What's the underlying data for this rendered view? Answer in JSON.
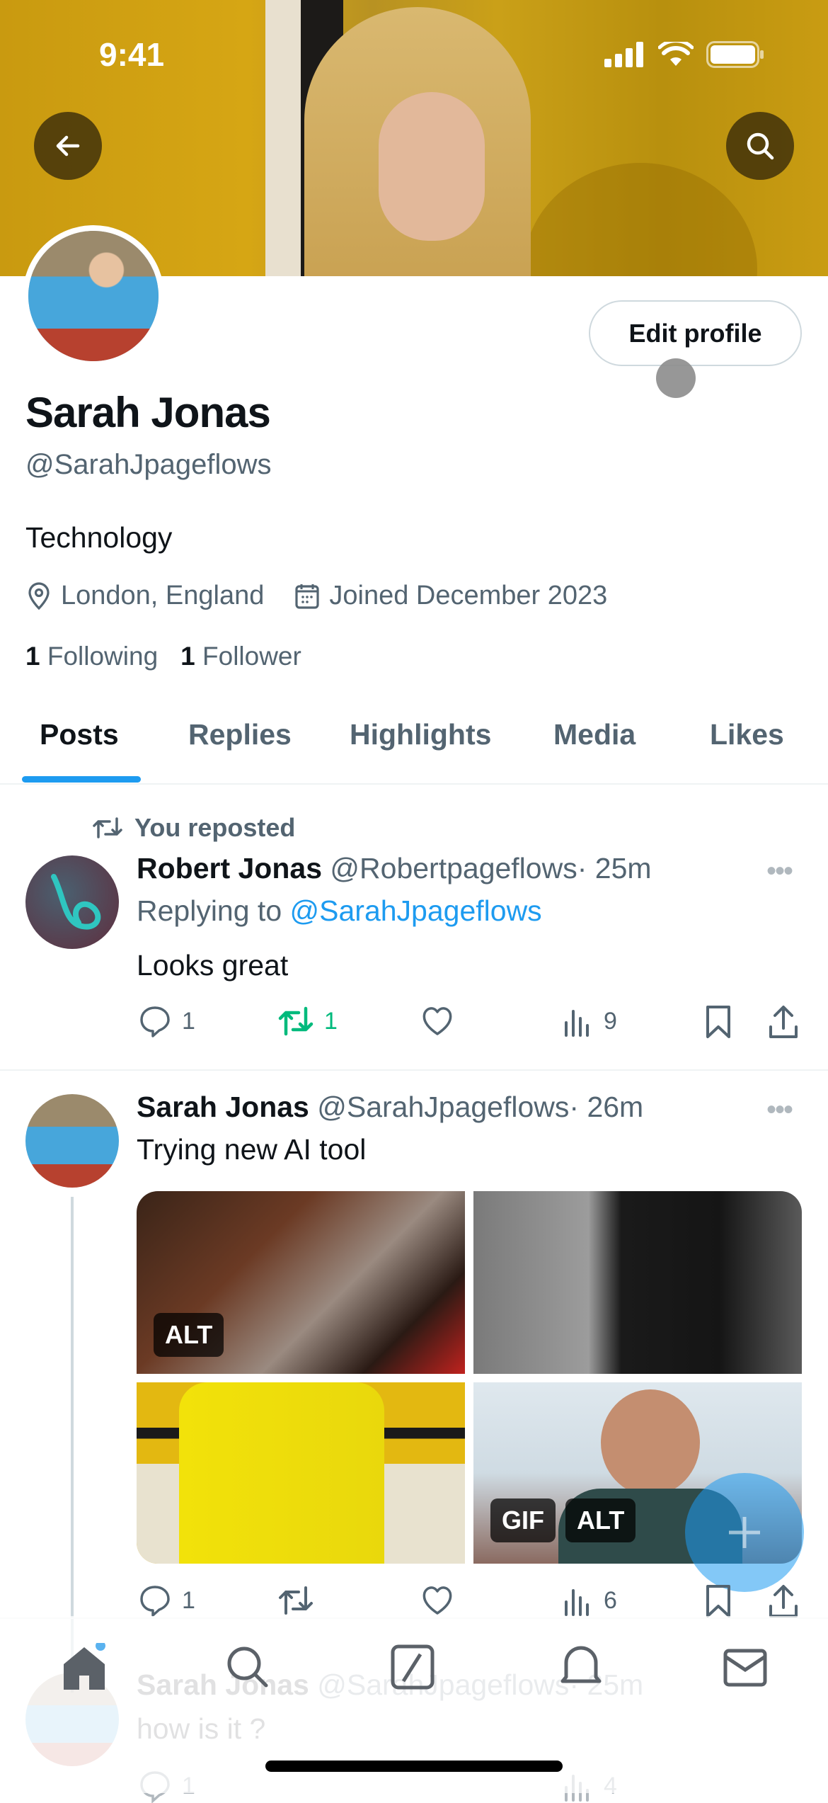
{
  "status_bar": {
    "time": "9:41"
  },
  "header": {
    "back_label": "Back",
    "search_label": "Search"
  },
  "profile": {
    "name": "Sarah Jonas",
    "handle": "@SarahJpageflows",
    "bio": "Technology",
    "location": "London, England",
    "joined": "Joined December 2023",
    "following_count": "1",
    "following_label": "Following",
    "followers_count": "1",
    "followers_label": "Follower",
    "edit_button": "Edit profile"
  },
  "tabs": [
    {
      "label": "Posts",
      "active": true
    },
    {
      "label": "Replies"
    },
    {
      "label": "Highlights"
    },
    {
      "label": "Media"
    },
    {
      "label": "Likes"
    }
  ],
  "posts": [
    {
      "context": "You reposted",
      "author": "Robert Jonas",
      "handle": "@Robertpageflows",
      "time": "· 25m",
      "replying_prefix": "Replying to",
      "replying_to": "@SarahJpageflows",
      "text": "Looks great",
      "replies": "1",
      "reposts": "1",
      "likes": "",
      "views": "9"
    },
    {
      "author": "Sarah Jonas",
      "handle": "@SarahJpageflows",
      "time": "· 26m",
      "text": "Trying new AI tool",
      "media_badges": [
        "ALT",
        "",
        "",
        "GIF",
        "ALT"
      ],
      "replies": "1",
      "reposts": "",
      "likes": "",
      "views": "6"
    },
    {
      "author": "Sarah Jonas",
      "handle": "@SarahJpageflows",
      "time": "· 25m",
      "text": "how is it ?",
      "replies": "1",
      "views": "4"
    }
  ],
  "media": {
    "badge_alt": "ALT",
    "badge_gif": "GIF"
  },
  "colors": {
    "accent": "#1d9bf0",
    "repost_active": "#00ba7c",
    "secondary_text": "#536471"
  }
}
